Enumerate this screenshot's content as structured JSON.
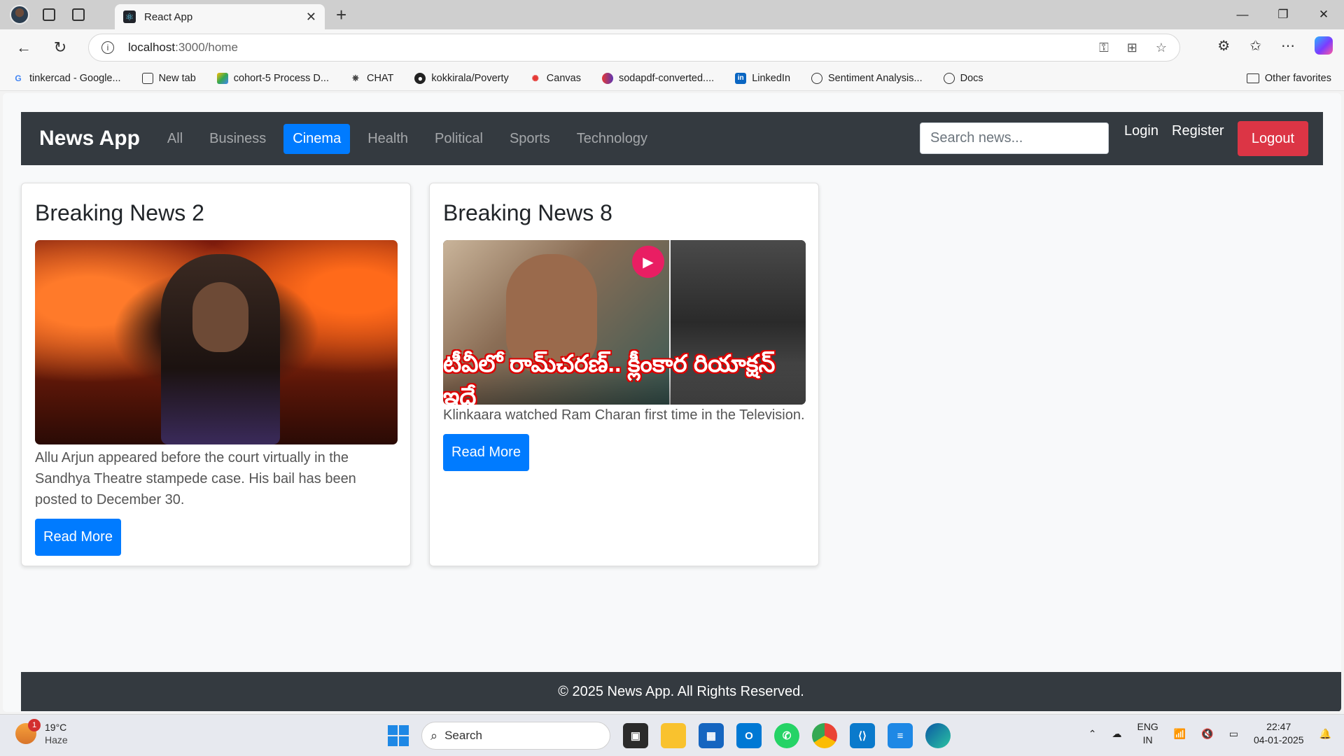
{
  "browser": {
    "tab_title": "React App",
    "url_host": "localhost",
    "url_path": ":3000/home",
    "bookmarks": [
      "tinkercad - Google...",
      "New tab",
      "cohort-5 Process D...",
      "CHAT",
      "kokkirala/Poverty",
      "Canvas",
      "sodapdf-converted....",
      "LinkedIn",
      "Sentiment Analysis...",
      "Docs"
    ],
    "other_favorites": "Other favorites"
  },
  "navbar": {
    "brand": "News App",
    "categories": [
      "All",
      "Business",
      "Cinema",
      "Health",
      "Political",
      "Sports",
      "Technology"
    ],
    "active_category": "Cinema",
    "search_placeholder": "Search news...",
    "login": "Login",
    "register": "Register",
    "logout": "Logout"
  },
  "articles": [
    {
      "title": "Breaking News 2",
      "description": "Allu Arjun appeared before the court virtually in the Sandhya Theatre stampede case. His bail has been posted to December 30.",
      "button": "Read More"
    },
    {
      "title": "Breaking News 8",
      "image_caption": "టీవీలో రామ్‌చరణ్.. క్లీంకార రియాక్షన్ ఇదే",
      "description": "Klinkaara watched Ram Charan first time in the Television.",
      "button": "Read More"
    }
  ],
  "footer": {
    "text": "© 2025 News App. All Rights Reserved."
  },
  "taskbar": {
    "weather_temp": "19°C",
    "weather_cond": "Haze",
    "weather_badge": "1",
    "search": "Search",
    "lang_1": "ENG",
    "lang_2": "IN",
    "time": "22:47",
    "date": "04-01-2025"
  },
  "colors": {
    "navbar_bg": "#343a40",
    "primary": "#007bff",
    "danger": "#dc3545"
  }
}
